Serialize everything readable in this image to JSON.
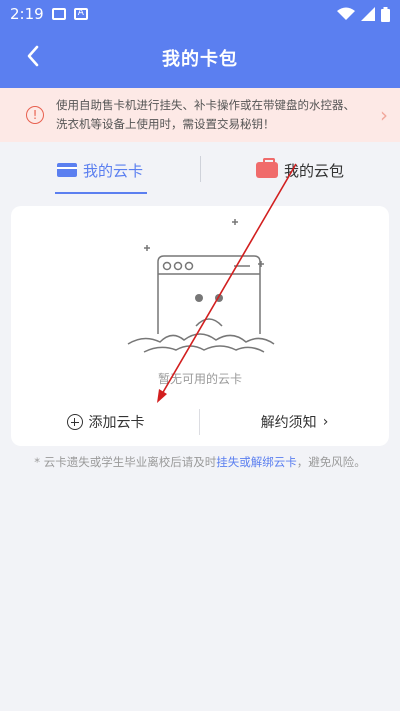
{
  "status_bar": {
    "time": "2:19"
  },
  "header": {
    "title": "我的卡包"
  },
  "notice": {
    "text": "使用自助售卡机进行挂失、补卡操作或在带键盘的水控器、洗衣机等设备上使用时，需设置交易秘钥！"
  },
  "tabs": [
    {
      "label": "我的云卡",
      "active": true
    },
    {
      "label": "我的云包",
      "active": false
    }
  ],
  "empty_state": {
    "text": "暂无可用的云卡"
  },
  "actions": {
    "add_card": "添加云卡",
    "unbind_notice": "解约须知"
  },
  "footnote": {
    "prefix": "* 云卡遗失或学生毕业离校后请及时",
    "link": "挂失或解绑云卡",
    "suffix": "，避免风险。"
  },
  "colors": {
    "primary": "#5b7ff0",
    "notice_bg": "#fde9e6",
    "annotation": "#d21f1f"
  }
}
